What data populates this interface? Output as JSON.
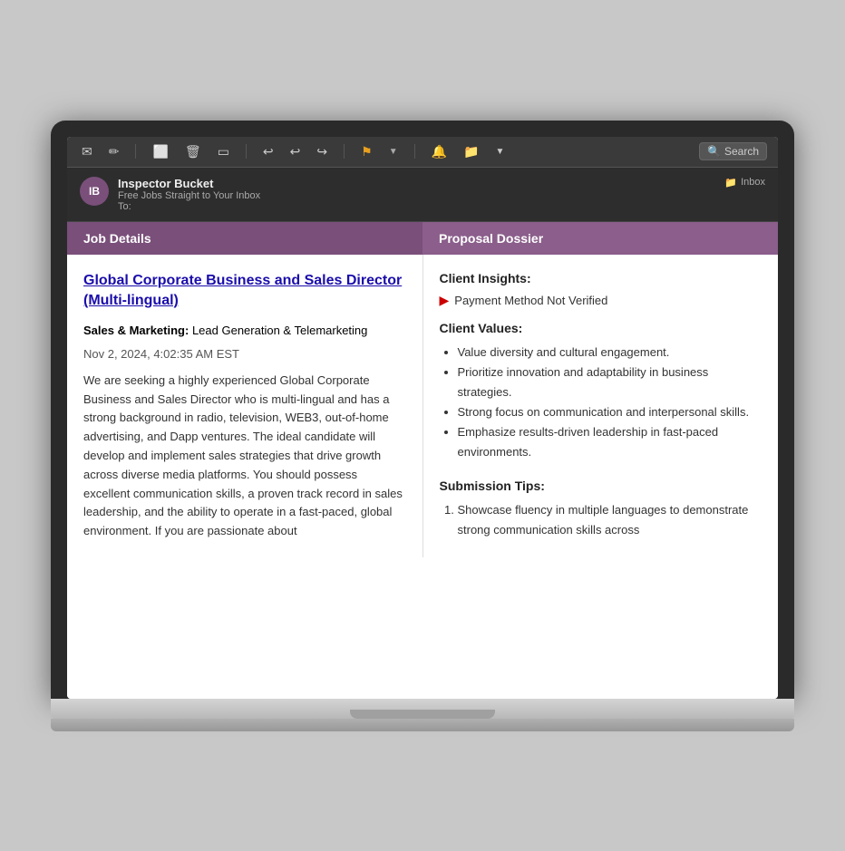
{
  "toolbar": {
    "icons": [
      "✉",
      "✏",
      "🗑",
      "🗑",
      "⬜",
      "↩",
      "↩",
      "↪",
      "⚑",
      "🔔",
      "📁",
      "🔍"
    ],
    "search_placeholder": "Search",
    "flag_button": "▼"
  },
  "email": {
    "sender_initials": "IB",
    "sender_name": "Inspector Bucket",
    "sender_sub": "Free Jobs Straight to Your Inbox",
    "sender_to": "To:",
    "folder_icon": "📁",
    "folder_name": "Inbox"
  },
  "job_details": {
    "header": "Job Details",
    "title": "Global Corporate Business and Sales Director (Multi-lingual)",
    "category_label": "Sales & Marketing:",
    "category_value": "Lead Generation & Telemarketing",
    "date": "Nov 2, 2024, 4:02:35 AM EST",
    "description": "We are seeking a highly experienced Global Corporate Business and Sales Director who is multi-lingual and has a strong background in radio, television, WEB3, out-of-home advertising, and Dapp ventures. The ideal candidate will develop and implement sales strategies that drive growth across diverse media platforms. You should possess excellent communication skills, a proven track record in sales leadership, and the ability to operate in a fast-paced, global environment. If you are passionate about"
  },
  "proposal_dossier": {
    "header": "Proposal Dossier",
    "client_insights_label": "Client Insights:",
    "payment_warning": "Payment Method Not Verified",
    "client_values_label": "Client Values:",
    "values": [
      "Value diversity and cultural engagement.",
      "Prioritize innovation and adaptability in business strategies.",
      "Strong focus on communication and interpersonal skills.",
      "Emphasize results-driven leadership in fast-paced environments."
    ],
    "submission_tips_label": "Submission Tips:",
    "tips": [
      "Showcase fluency in multiple languages to demonstrate strong communication skills across"
    ]
  }
}
